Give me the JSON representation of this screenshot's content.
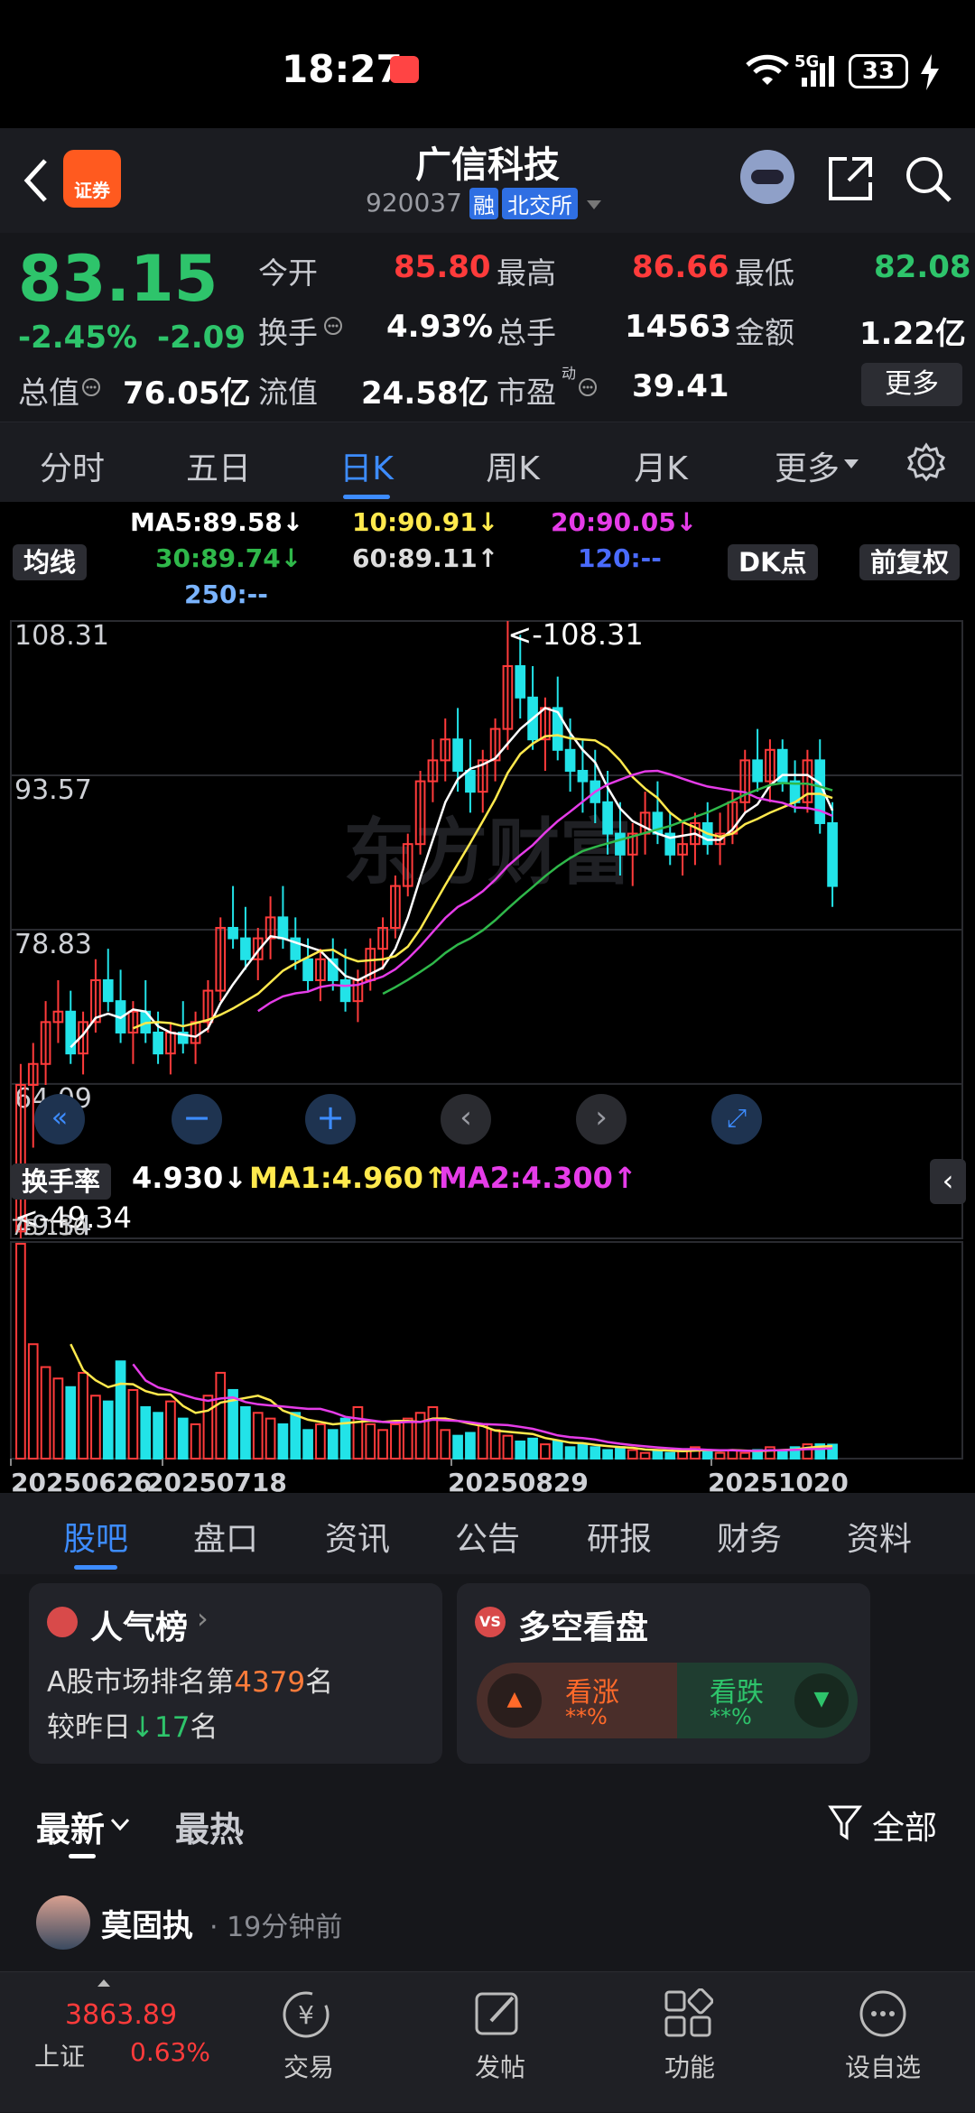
{
  "status": {
    "time": "18:27",
    "battery": "33",
    "net": "5G"
  },
  "header": {
    "title": "广信科技",
    "code": "920037",
    "badge_rong": "融",
    "badge_exchange": "北交所",
    "logo_text": "证券"
  },
  "quote": {
    "price": "83.15",
    "change_pct": "-2.45%",
    "change": "-2.09",
    "open_label": "今开",
    "open": "85.80",
    "high_label": "最高",
    "high": "86.66",
    "low_label": "最低",
    "low": "82.08",
    "turnover_label": "换手",
    "turnover": "4.93%",
    "volume_label": "总手",
    "volume": "14563",
    "amount_label": "金额",
    "amount": "1.22亿",
    "mktcap_label": "总值",
    "mktcap": "76.05亿",
    "float_label": "流值",
    "float": "24.58亿",
    "pe_label": "市盈",
    "pe_sup": "动",
    "pe": "39.41",
    "more": "更多"
  },
  "period_tabs": [
    "分时",
    "五日",
    "日K",
    "周K",
    "月K",
    "更多"
  ],
  "period_active": 2,
  "ma_legend": {
    "selector": "均线",
    "ma5": "MA5:89.58↓",
    "ma10": "10:90.91↓",
    "ma20": "20:90.05↓",
    "ma30": "30:89.74↓",
    "ma60": "60:89.11↑",
    "ma120": "120:--",
    "ma250": "250:--",
    "dk": "DK点",
    "fq": "前复权"
  },
  "colors": {
    "up": "#ff3b3b",
    "down": "#22e3e8",
    "ma5": "#ffffff",
    "ma10": "#ffe94d",
    "ma20": "#e53ce8",
    "ma30": "#2fb84a",
    "ma120": "#4a6bff",
    "ma250": "#7ab4ff"
  },
  "chart_labels": {
    "y_ticks": [
      "108.31",
      "93.57",
      "78.83",
      "64.09",
      "49.34"
    ],
    "max_label": "<-108.31",
    "min_label": "<-49.34",
    "watermark": "东方财富"
  },
  "sub_legend": {
    "selector": "换手率",
    "value": "4.930↓",
    "ma1": "MA1:4.960↑",
    "ma2": "MA2:4.300↑",
    "y_max": "75.110"
  },
  "x_labels": [
    "20250626",
    "20250718",
    "20250829",
    "20251020"
  ],
  "chart_data": {
    "type": "candlestick",
    "y_ticks": [
      108.31,
      93.57,
      78.83,
      64.09,
      49.34
    ],
    "ylim": [
      49.34,
      108.31
    ],
    "max": 108.31,
    "min": 49.34,
    "candles": [
      [
        50,
        66,
        49.34,
        64
      ],
      [
        64,
        68,
        58,
        66
      ],
      [
        66,
        72,
        64,
        70
      ],
      [
        70,
        74,
        68,
        71
      ],
      [
        71,
        73,
        66,
        67
      ],
      [
        67,
        71,
        65,
        70
      ],
      [
        70,
        76,
        69,
        74
      ],
      [
        74,
        77,
        71,
        72
      ],
      [
        72,
        75,
        68,
        69
      ],
      [
        69,
        72,
        66,
        71
      ],
      [
        71,
        74,
        68,
        69
      ],
      [
        69,
        71,
        66,
        67
      ],
      [
        67,
        70,
        65,
        69
      ],
      [
        69,
        72,
        67,
        68
      ],
      [
        68,
        71,
        66,
        70
      ],
      [
        70,
        74,
        69,
        73
      ],
      [
        73,
        80,
        72,
        79
      ],
      [
        79,
        83,
        77,
        78
      ],
      [
        78,
        81,
        75,
        76
      ],
      [
        76,
        79,
        74,
        78
      ],
      [
        78,
        82,
        76,
        80
      ],
      [
        80,
        83,
        77,
        78
      ],
      [
        78,
        80,
        75,
        76
      ],
      [
        76,
        78,
        73,
        74
      ],
      [
        74,
        77,
        72,
        76
      ],
      [
        76,
        78,
        73,
        74
      ],
      [
        74,
        77,
        71,
        72
      ],
      [
        72,
        75,
        70,
        74
      ],
      [
        74,
        78,
        73,
        77
      ],
      [
        77,
        80,
        75,
        79
      ],
      [
        79,
        84,
        78,
        83
      ],
      [
        83,
        88,
        82,
        87
      ],
      [
        87,
        94,
        86,
        93
      ],
      [
        93,
        97,
        91,
        95
      ],
      [
        95,
        99,
        93,
        97
      ],
      [
        97,
        100,
        92,
        94
      ],
      [
        94,
        97,
        90,
        92
      ],
      [
        92,
        96,
        90,
        95
      ],
      [
        95,
        99,
        93,
        98
      ],
      [
        98,
        108.31,
        96,
        104
      ],
      [
        104,
        107,
        99,
        101
      ],
      [
        101,
        104,
        96,
        97
      ],
      [
        97,
        101,
        94,
        100
      ],
      [
        100,
        103,
        95,
        96
      ],
      [
        96,
        99,
        92,
        94
      ],
      [
        94,
        97,
        90,
        93
      ],
      [
        93,
        96,
        89,
        91
      ],
      [
        91,
        94,
        86,
        88
      ],
      [
        88,
        91,
        84,
        86
      ],
      [
        86,
        89,
        83,
        88
      ],
      [
        88,
        92,
        86,
        90
      ],
      [
        90,
        93,
        87,
        88
      ],
      [
        88,
        90,
        85,
        86
      ],
      [
        86,
        89,
        84,
        87
      ],
      [
        87,
        90,
        85,
        89
      ],
      [
        89,
        91,
        86,
        87
      ],
      [
        87,
        90,
        85,
        88
      ],
      [
        88,
        92,
        87,
        91
      ],
      [
        91,
        96,
        90,
        95
      ],
      [
        95,
        98,
        92,
        93
      ],
      [
        93,
        97,
        91,
        96
      ],
      [
        96,
        97,
        92,
        93
      ],
      [
        93,
        95,
        90,
        91
      ],
      [
        91,
        96,
        90,
        95
      ],
      [
        95,
        97,
        88,
        89
      ],
      [
        89,
        91,
        81,
        83
      ]
    ],
    "turnover": [
      75.1,
      40,
      32,
      28,
      25,
      30,
      22,
      20,
      34,
      24,
      18,
      16,
      20,
      14,
      12,
      22,
      30,
      24,
      18,
      16,
      14,
      12,
      16,
      10,
      12,
      10,
      14,
      18,
      12,
      10,
      12,
      14,
      16,
      18,
      10,
      8,
      9,
      12,
      10,
      8,
      6,
      7,
      5,
      6,
      4,
      5,
      4,
      3,
      4,
      3,
      2,
      3,
      2,
      3,
      4,
      3,
      2,
      3,
      2,
      3,
      4,
      3,
      4,
      5,
      5,
      4.9
    ],
    "ma": {
      "MA5": 89.58,
      "MA10": 90.91,
      "MA20": 90.05,
      "MA30": 89.74,
      "MA60": 89.11,
      "MA120": "--",
      "MA250": "--"
    },
    "turnover_ma": {
      "MA1": 4.96,
      "MA2": 4.3,
      "value": 4.93
    }
  },
  "info_tabs": [
    "股吧",
    "盘口",
    "资讯",
    "公告",
    "研报",
    "财务",
    "资料"
  ],
  "cards": {
    "rank_title": "人气榜",
    "rank_line1_pre": "A股市场排名第",
    "rank_num": "4379",
    "rank_line1_post": "名",
    "rank_line2_pre": "较昨日",
    "rank_change": "17",
    "rank_line2_post": "名",
    "vs_title": "多空看盘",
    "vs_icon": "VS",
    "bull_label": "看涨",
    "bull_val": "**%",
    "bear_label": "看跌",
    "bear_val": "**%"
  },
  "sort_tabs": {
    "latest": "最新",
    "hot": "最热",
    "filter": "全部"
  },
  "post": {
    "author": "莫固执",
    "time": "· 19分钟前"
  },
  "bottom": {
    "index_val": "3863.89",
    "index_name": "上证",
    "index_pct": "0.63%",
    "trade": "交易",
    "post": "发帖",
    "func": "功能",
    "fav": "设自选"
  }
}
